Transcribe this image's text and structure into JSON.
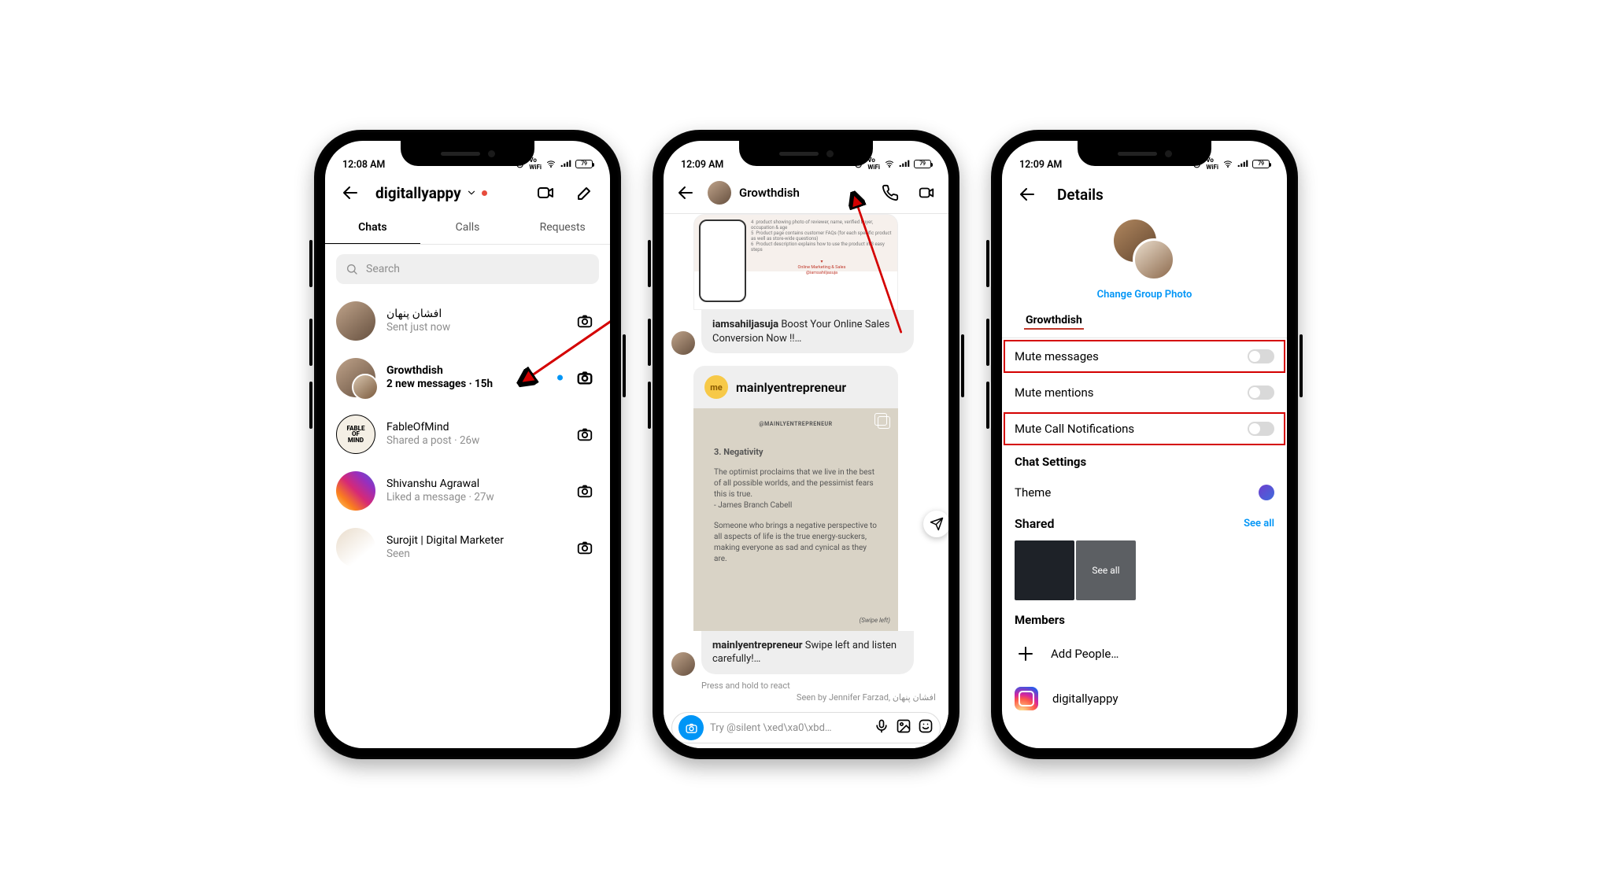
{
  "common": {
    "battery_text": "79"
  },
  "phone1": {
    "status_time": "12:08 AM",
    "header_title": "digitallyappy",
    "tabs": [
      "Chats",
      "Calls",
      "Requests"
    ],
    "search_placeholder": "Search",
    "chats": [
      {
        "name": "افشان پنهان",
        "sub": "Sent just now"
      },
      {
        "name": "Growthdish",
        "sub": "2 new messages · 15h",
        "unread": true
      },
      {
        "name": "FableOfMind",
        "sub": "Shared a post · 26w"
      },
      {
        "name": "Shivanshu Agrawal",
        "sub": "Liked a message · 27w"
      },
      {
        "name": "Surojit | Digital Marketer",
        "sub": "Seen"
      }
    ]
  },
  "phone2": {
    "status_time": "12:09 AM",
    "chat_title": "Growthdish",
    "post_caption_user": "iamsahiljasuja",
    "post_caption_text": " Boost Your Online Sales Conversion Now !!…",
    "repost_user": "mainlyentrepreneur",
    "repost_handle": "@MAINLYENTREPRENEUR",
    "repost_heading": "3. Negativity",
    "repost_p1": "The optimist proclaims that we live in the best of all possible worlds, and the pessimist fears this is true.\n- James Branch Cabell",
    "repost_p2": "Someone who brings a negative perspective to all aspects of life is the true energy-suckers, making everyone as sad and cynical as they are.",
    "repost_swipe": "(Swipe left)",
    "repost_caption_user": "mainlyentrepreneur",
    "repost_caption_text": " Swipe left and listen carefully!…",
    "react_hint": "Press and hold to react",
    "seen_by": "Seen by Jennifer Farzad, افشان پنهان",
    "compose_placeholder": "Try @silent \\xed\\xa0\\xbd…"
  },
  "phone3": {
    "status_time": "12:09 AM",
    "title": "Details",
    "change_photo": "Change Group Photo",
    "group_name": "Growthdish",
    "settings": [
      {
        "label": "Mute messages",
        "boxed": true,
        "toggle": true
      },
      {
        "label": "Mute mentions",
        "boxed": false,
        "toggle": true
      },
      {
        "label": "Mute Call Notifications",
        "boxed": true,
        "toggle": true
      }
    ],
    "chat_settings": "Chat Settings",
    "theme": "Theme",
    "shared": "Shared",
    "see_all": "See all",
    "members": "Members",
    "add_people": "Add People…",
    "member_name": "digitallyappy"
  }
}
